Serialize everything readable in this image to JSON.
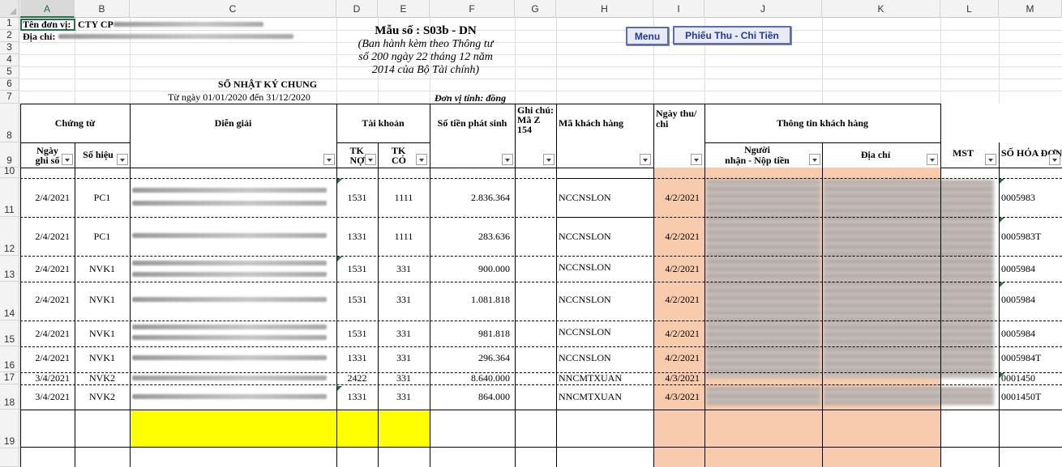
{
  "columns": [
    "A",
    "B",
    "C",
    "D",
    "E",
    "F",
    "G",
    "H",
    "I",
    "J",
    "K",
    "L",
    "M"
  ],
  "rows": [
    "1",
    "2",
    "3",
    "4",
    "5",
    "6",
    "7",
    "8",
    "9",
    "10",
    "11",
    "12",
    "13",
    "14",
    "15",
    "16",
    "17",
    "18",
    "19"
  ],
  "header": {
    "company_label": "Tên đơn vị:",
    "company_value": "CTY CP",
    "address_label": "Địa chỉ:",
    "form_number": "Mẫu số : S03b - DN",
    "decree_line1": "(Ban hành kèm theo Thông tư",
    "decree_line2": "số 200 ngày 22 tháng 12 năm",
    "decree_line3": "2014 của Bộ Tài chính)",
    "ledger_title": "SỔ NHẬT KÝ CHUNG",
    "period": "Từ ngày 01/01/2020   đến 31/12/2020",
    "currency_unit": "Đơn vị tính: đồng"
  },
  "buttons": {
    "menu": "Menu",
    "receipts": "Phiếu  Thu - Chi Tiền"
  },
  "table_headers": {
    "voucher": "Chứng từ",
    "date": "Ngày\nghi sổ",
    "number": "Số hiệu",
    "description": "Diễn giải",
    "account": "Tài khoản",
    "debit": "TK\nNỢ",
    "credit": "TK\nCÓ",
    "amount": "Số tiền phát sinh",
    "note": "Ghi chú:\nMã Z\n154",
    "customer_code": "Mã khách hàng",
    "pay_date": "Ngày thu/\nchi",
    "customer_info": "Thông tin khách hàng",
    "payer": "Người\nnhận - Nộp tiền",
    "address": "Địa chỉ",
    "tax_code": "MST",
    "invoice_no": "SỐ HÓA ĐƠN"
  },
  "entries": [
    {
      "date": "2/4/2021",
      "num": "PC1",
      "dr": "1531",
      "cr": "1111",
      "amount": "2.836.364",
      "cust": "NCCNSLON",
      "pay_date": "4/2/2021",
      "invoice": "0005983"
    },
    {
      "date": "2/4/2021",
      "num": "PC1",
      "dr": "1331",
      "cr": "1111",
      "amount": "283.636",
      "cust": "NCCNSLON",
      "pay_date": "4/2/2021",
      "invoice": "0005983T"
    },
    {
      "date": "2/4/2021",
      "num": "NVK1",
      "dr": "1531",
      "cr": "331",
      "amount": "900.000",
      "cust": "NCCNSLON",
      "pay_date": "4/2/2021",
      "invoice": "0005984"
    },
    {
      "date": "2/4/2021",
      "num": "NVK1",
      "dr": "1531",
      "cr": "331",
      "amount": "1.081.818",
      "cust": "NCCNSLON",
      "pay_date": "4/2/2021",
      "invoice": "0005984"
    },
    {
      "date": "2/4/2021",
      "num": "NVK1",
      "dr": "1531",
      "cr": "331",
      "amount": "981.818",
      "cust": "NCCNSLON",
      "pay_date": "4/2/2021",
      "invoice": "0005984"
    },
    {
      "date": "2/4/2021",
      "num": "NVK1",
      "dr": "1331",
      "cr": "331",
      "amount": "296.364",
      "cust": "NCCNSLON",
      "pay_date": "4/2/2021",
      "invoice": "0005984T"
    },
    {
      "date": "3/4/2021",
      "num": "NVK2",
      "dr": "2422",
      "cr": "331",
      "amount": "8.640.000",
      "cust": "NNCMTXUAN",
      "pay_date": "4/3/2021",
      "invoice": "0001450"
    },
    {
      "date": "3/4/2021",
      "num": "NVK2",
      "dr": "1331",
      "cr": "331",
      "amount": "864.000",
      "cust": "NNCMTXUAN",
      "pay_date": "4/3/2021",
      "invoice": "0001450T"
    }
  ],
  "colors": {
    "highlight_yellow": "#ffff00",
    "highlight_peach": "#f8cbad",
    "button_border": "#5a6fb0",
    "excel_green": "#217346"
  }
}
